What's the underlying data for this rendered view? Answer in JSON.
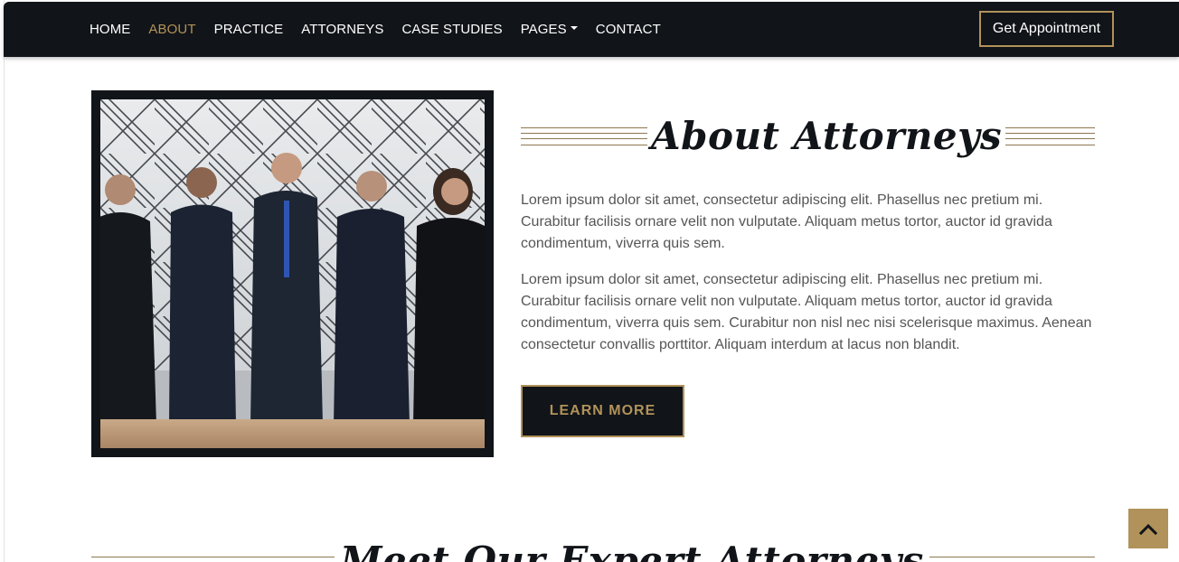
{
  "nav": {
    "links": [
      {
        "label": "HOME"
      },
      {
        "label": "ABOUT"
      },
      {
        "label": "PRACTICE"
      },
      {
        "label": "ATTORNEYS"
      },
      {
        "label": "CASE STUDIES"
      },
      {
        "label": "PAGES"
      },
      {
        "label": "CONTACT"
      }
    ],
    "active": "ABOUT",
    "cta_label": "Get Appointment"
  },
  "about": {
    "title": "About Attorneys",
    "paragraph1": "Lorem ipsum dolor sit amet, consectetur adipiscing elit. Phasellus nec pretium mi. Curabitur facilisis ornare velit non vulputate. Aliquam metus tortor, auctor id gravida condimentum, viverra quis sem.",
    "paragraph2": "Lorem ipsum dolor sit amet, consectetur adipiscing elit. Phasellus nec pretium mi. Curabitur facilisis ornare velit non vulputate. Aliquam metus tortor, auctor id gravida condimentum, viverra quis sem. Curabitur non nisl nec nisi scelerisque maximus. Aenean consectetur convallis porttitor. Aliquam interdum at lacus non blandit.",
    "button_label": "LEARN MORE"
  },
  "next_section": {
    "title": "Meet Our Expert Attorneys"
  },
  "colors": {
    "dark": "#111418",
    "accent": "#b1925a",
    "text": "#555555"
  },
  "icons": {
    "pages_caret": "caret-down-icon",
    "back_to_top": "chevron-up-icon"
  }
}
